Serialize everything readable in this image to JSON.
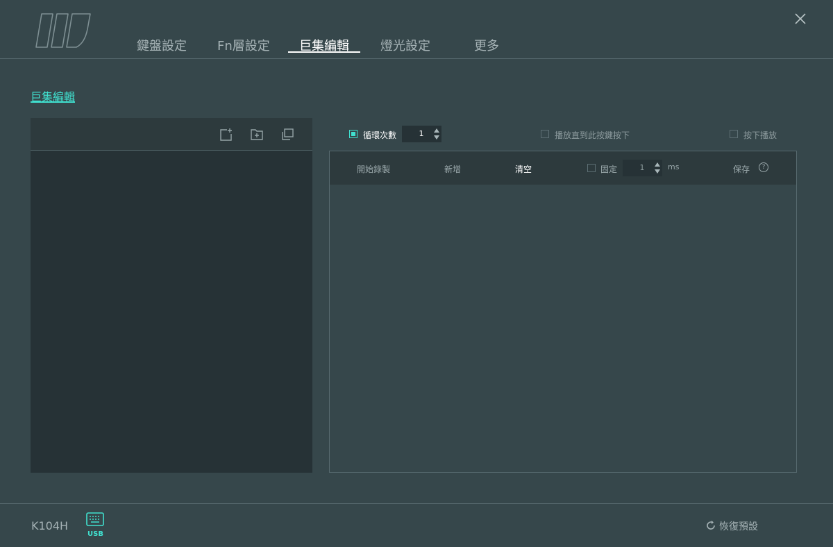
{
  "nav": {
    "tabs": [
      "鍵盤設定",
      "Fn層設定",
      "巨集編輯",
      "燈光設定",
      "更多"
    ],
    "active_tab": "巨集編輯"
  },
  "section_title": "巨集編輯",
  "options": {
    "loop_label": "循環次數",
    "loop_count": "1",
    "play_until_pressed_label": "播放直到此按鍵按下",
    "press_play_label": "按下播放"
  },
  "macro_toolbar": {
    "start_record": "開始錄製",
    "add": "新增",
    "clear": "清空",
    "fixed_label": "固定",
    "fixed_value": "1",
    "unit": "ms",
    "save": "保存",
    "help_glyph": "?"
  },
  "footer": {
    "model": "K104H",
    "connection": "USB",
    "reset_label": "恢復預設"
  },
  "colors": {
    "background": "#36474b",
    "panel_dark": "#263236",
    "toolbar": "#2d3a3d",
    "accent": "#40e0cf"
  },
  "icons": [
    "logo",
    "close-icon",
    "new-macro-icon",
    "new-folder-icon",
    "copy-icon",
    "keyboard-icon",
    "help-icon",
    "refresh-icon"
  ]
}
